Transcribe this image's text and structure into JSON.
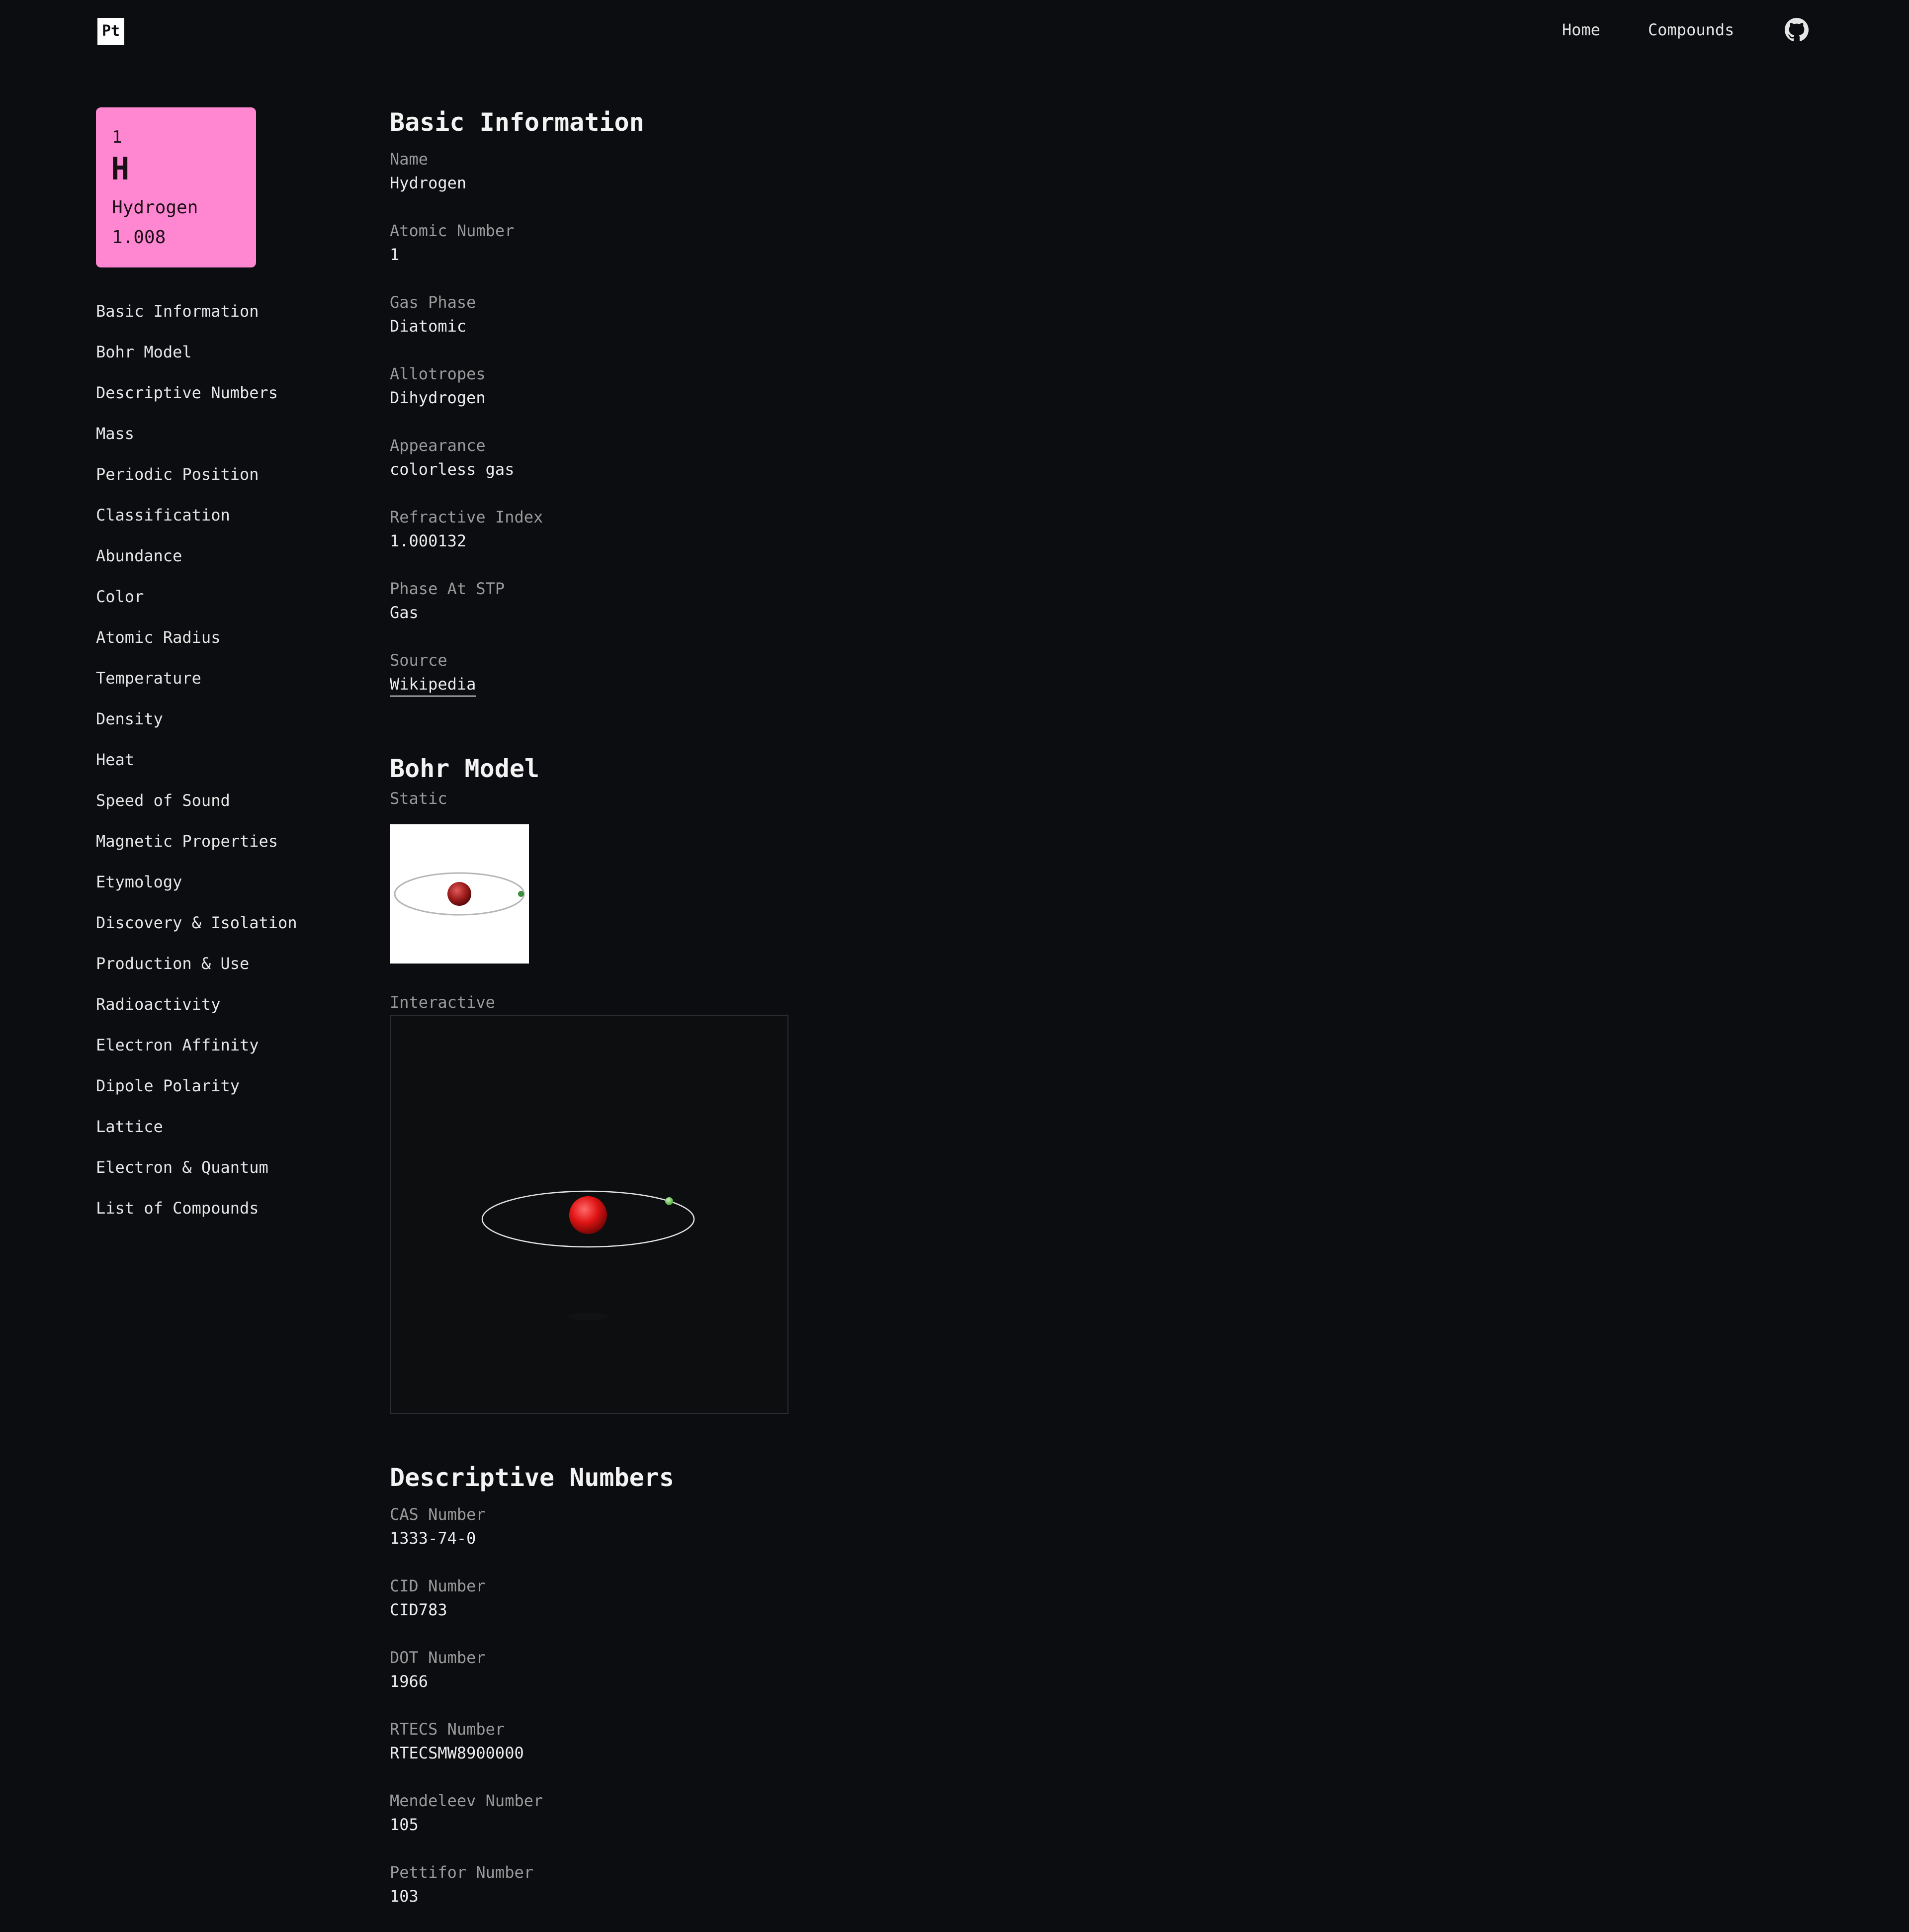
{
  "header": {
    "logo": "Pt",
    "nav": [
      "Home",
      "Compounds"
    ],
    "github_icon": "github-icon"
  },
  "element": {
    "number": "1",
    "symbol": "H",
    "name": "Hydrogen",
    "mass": "1.008",
    "color": "#ff86d1"
  },
  "sidebar": {
    "items": [
      "Basic Information",
      "Bohr Model",
      "Descriptive Numbers",
      "Mass",
      "Periodic Position",
      "Classification",
      "Abundance",
      "Color",
      "Atomic Radius",
      "Temperature",
      "Density",
      "Heat",
      "Speed of Sound",
      "Magnetic Properties",
      "Etymology",
      "Discovery & Isolation",
      "Production & Use",
      "Radioactivity",
      "Electron Affinity",
      "Dipole Polarity",
      "Lattice",
      "Electron & Quantum",
      "List of Compounds"
    ]
  },
  "basic": {
    "title": "Basic Information",
    "fields": [
      {
        "label": "Name",
        "value": "Hydrogen"
      },
      {
        "label": "Atomic Number",
        "value": "1"
      },
      {
        "label": "Gas Phase",
        "value": "Diatomic"
      },
      {
        "label": "Allotropes",
        "value": "Dihydrogen"
      },
      {
        "label": "Appearance",
        "value": "colorless gas"
      },
      {
        "label": "Refractive Index",
        "value": "1.000132"
      },
      {
        "label": "Phase At STP",
        "value": "Gas"
      }
    ],
    "source_label": "Source",
    "source_link": "Wikipedia"
  },
  "bohr": {
    "title": "Bohr Model",
    "static_label": "Static",
    "interactive_label": "Interactive"
  },
  "descriptive": {
    "title": "Descriptive Numbers",
    "fields": [
      {
        "label": "CAS Number",
        "value": "1333-74-0"
      },
      {
        "label": "CID Number",
        "value": "CID783"
      },
      {
        "label": "DOT Number",
        "value": "1966"
      },
      {
        "label": "RTECS Number",
        "value": "RTECSMW8900000"
      },
      {
        "label": "Mendeleev Number",
        "value": "105"
      },
      {
        "label": "Pettifor Number",
        "value": "103"
      }
    ]
  }
}
